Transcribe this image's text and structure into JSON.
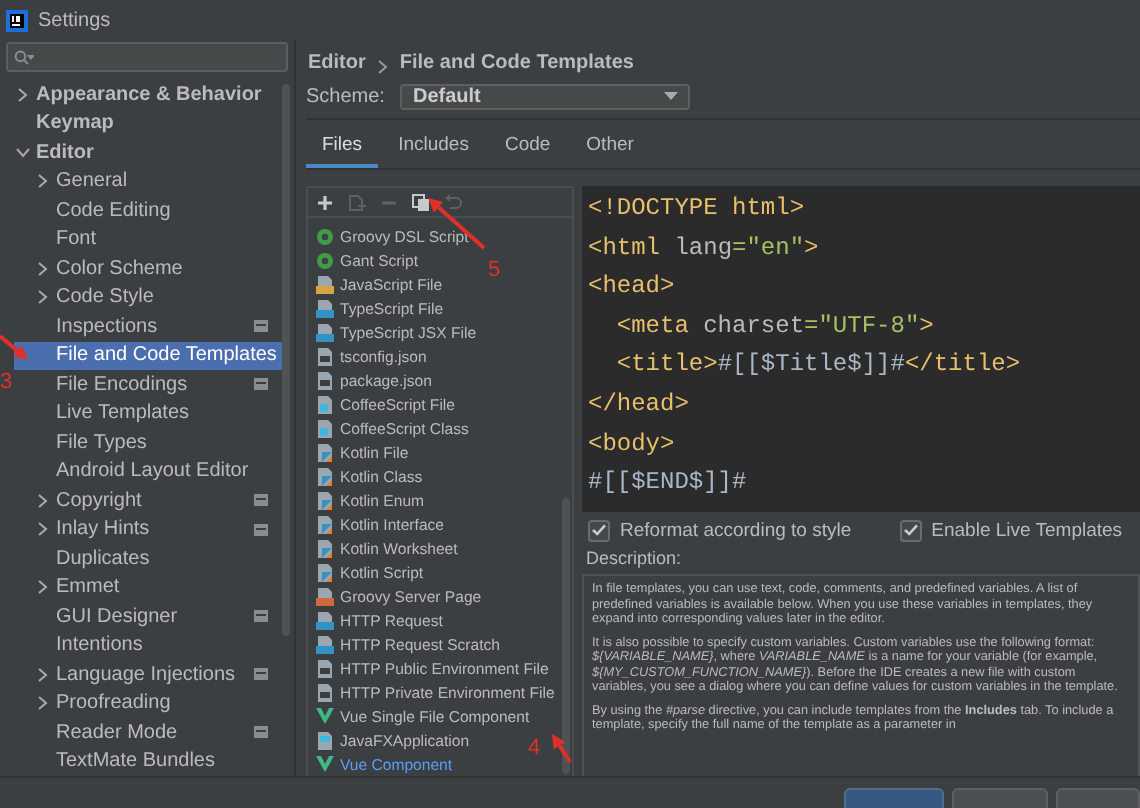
{
  "window": {
    "title": "Settings"
  },
  "sidebar": {
    "items": [
      {
        "label": "Appearance & Behavior",
        "kind": "folder",
        "expanded": false,
        "selected": false,
        "project_level": false
      },
      {
        "label": "Keymap",
        "kind": "page",
        "selected": false,
        "project_level": false
      },
      {
        "label": "Editor",
        "kind": "folder",
        "expanded": true,
        "selected": false,
        "project_level": false,
        "children": [
          {
            "label": "General",
            "kind": "folder",
            "expanded": false,
            "selected": false,
            "project_level": false
          },
          {
            "label": "Code Editing",
            "kind": "page",
            "selected": false,
            "project_level": false
          },
          {
            "label": "Font",
            "kind": "page",
            "selected": false,
            "project_level": false
          },
          {
            "label": "Color Scheme",
            "kind": "folder",
            "expanded": false,
            "selected": false,
            "project_level": false
          },
          {
            "label": "Code Style",
            "kind": "folder",
            "expanded": false,
            "selected": false,
            "project_level": false
          },
          {
            "label": "Inspections",
            "kind": "page",
            "selected": false,
            "project_level": true
          },
          {
            "label": "File and Code Templates",
            "kind": "page",
            "selected": true,
            "project_level": false
          },
          {
            "label": "File Encodings",
            "kind": "page",
            "selected": false,
            "project_level": true
          },
          {
            "label": "Live Templates",
            "kind": "page",
            "selected": false,
            "project_level": false
          },
          {
            "label": "File Types",
            "kind": "page",
            "selected": false,
            "project_level": false
          },
          {
            "label": "Android Layout Editor",
            "kind": "page",
            "selected": false,
            "project_level": false
          },
          {
            "label": "Copyright",
            "kind": "folder",
            "expanded": false,
            "selected": false,
            "project_level": true
          },
          {
            "label": "Inlay Hints",
            "kind": "folder",
            "expanded": false,
            "selected": false,
            "project_level": true
          },
          {
            "label": "Duplicates",
            "kind": "page",
            "selected": false,
            "project_level": false
          },
          {
            "label": "Emmet",
            "kind": "folder",
            "expanded": false,
            "selected": false,
            "project_level": false
          },
          {
            "label": "GUI Designer",
            "kind": "page",
            "selected": false,
            "project_level": true
          },
          {
            "label": "Intentions",
            "kind": "page",
            "selected": false,
            "project_level": false
          },
          {
            "label": "Language Injections",
            "kind": "folder",
            "expanded": false,
            "selected": false,
            "project_level": true
          },
          {
            "label": "Proofreading",
            "kind": "folder",
            "expanded": false,
            "selected": false,
            "project_level": false
          },
          {
            "label": "Reader Mode",
            "kind": "page",
            "selected": false,
            "project_level": true
          },
          {
            "label": "TextMate Bundles",
            "kind": "page",
            "selected": false,
            "project_level": false
          }
        ]
      }
    ]
  },
  "breadcrumb": [
    "Editor",
    "File and Code Templates"
  ],
  "scheme": {
    "label": "Scheme:",
    "value": "Default"
  },
  "tabs": [
    {
      "label": "Files",
      "selected": true
    },
    {
      "label": "Includes",
      "selected": false
    },
    {
      "label": "Code",
      "selected": false
    },
    {
      "label": "Other",
      "selected": false
    }
  ],
  "toolbar": [
    {
      "kind": "add",
      "disabled": false
    },
    {
      "kind": "child",
      "disabled": true
    },
    {
      "kind": "remove",
      "disabled": true
    },
    {
      "kind": "copy",
      "disabled": false
    },
    {
      "kind": "reset",
      "disabled": true
    }
  ],
  "templates": [
    {
      "label": "Groovy DSL Script",
      "kind": "groovy",
      "modified": false
    },
    {
      "label": "Gant Script",
      "kind": "groovy",
      "modified": false
    },
    {
      "label": "JavaScript File",
      "kind": "js",
      "modified": false
    },
    {
      "label": "TypeScript File",
      "kind": "ts",
      "modified": false
    },
    {
      "label": "TypeScript JSX File",
      "kind": "ts",
      "modified": false
    },
    {
      "label": "tsconfig.json",
      "kind": "json",
      "modified": false
    },
    {
      "label": "package.json",
      "kind": "json",
      "modified": false
    },
    {
      "label": "CoffeeScript File",
      "kind": "coffee",
      "modified": false
    },
    {
      "label": "CoffeeScript Class",
      "kind": "coffee",
      "modified": false
    },
    {
      "label": "Kotlin File",
      "kind": "kotlin",
      "modified": false
    },
    {
      "label": "Kotlin Class",
      "kind": "kotlin",
      "modified": false
    },
    {
      "label": "Kotlin Enum",
      "kind": "kotlin",
      "modified": false
    },
    {
      "label": "Kotlin Interface",
      "kind": "kotlin",
      "modified": false
    },
    {
      "label": "Kotlin Worksheet",
      "kind": "kotlin",
      "modified": false
    },
    {
      "label": "Kotlin Script",
      "kind": "kotlin",
      "modified": false
    },
    {
      "label": "Groovy Server Page",
      "kind": "gsp",
      "modified": false
    },
    {
      "label": "HTTP Request",
      "kind": "http",
      "modified": false
    },
    {
      "label": "HTTP Request Scratch",
      "kind": "http",
      "modified": false
    },
    {
      "label": "HTTP Public Environment File",
      "kind": "json",
      "modified": false
    },
    {
      "label": "HTTP Private Environment File",
      "kind": "json",
      "modified": false
    },
    {
      "label": "Vue Single File Component",
      "kind": "vue",
      "modified": false
    },
    {
      "label": "JavaFXApplication",
      "kind": "javafx",
      "modified": false
    },
    {
      "label": "Vue Component",
      "kind": "vue",
      "modified": true
    }
  ],
  "code": [
    [
      {
        "text": "<!DOCTYPE html>",
        "kind": "tag"
      }
    ],
    [
      {
        "text": "<html ",
        "kind": "tag"
      },
      {
        "text": "lang",
        "kind": "attr"
      },
      {
        "text": "=\"en\"",
        "kind": "string"
      },
      {
        "text": ">",
        "kind": "tag"
      }
    ],
    [
      {
        "text": "<head>",
        "kind": "tag"
      }
    ],
    [
      {
        "text": "  <meta ",
        "kind": "tag"
      },
      {
        "text": "charset",
        "kind": "attr"
      },
      {
        "text": "=\"UTF-8\"",
        "kind": "string"
      },
      {
        "text": ">",
        "kind": "tag"
      }
    ],
    [
      {
        "text": "  <title>",
        "kind": "tag"
      },
      {
        "text": "#[[$Title$]]#",
        "kind": "plain"
      },
      {
        "text": "</title>",
        "kind": "tag"
      }
    ],
    [
      {
        "text": "</head>",
        "kind": "tag"
      }
    ],
    [
      {
        "text": "<body>",
        "kind": "tag"
      }
    ],
    [
      {
        "text": "#[[$END$]]#",
        "kind": "plain"
      }
    ]
  ],
  "options": [
    {
      "label": "Reformat according to style",
      "checked": true
    },
    {
      "label": "Enable Live Templates",
      "checked": true
    }
  ],
  "description": {
    "label": "Description:",
    "paragraphs": [
      "In file templates, you can use text, code, comments, and predefined variables. A list of predefined variables is available below. When you use these variables in templates, they expand into corresponding values later in the editor.",
      "It is also possible to specify custom variables. Custom variables use the following format: *${VARIABLE_NAME}*, where *VARIABLE_NAME* is a name for your variable (for example, *${MY_CUSTOM_FUNCTION_NAME}*). Before the IDE creates a new file with custom variables, you see a dialog where you can define values for custom variables in the template.",
      "By using the *#parse* directive, you can include templates from the **Includes** tab. To include a template, specify the full name of the template as a parameter in"
    ]
  },
  "annotations": [
    {
      "label": "3"
    },
    {
      "label": "4"
    },
    {
      "label": "5"
    }
  ]
}
